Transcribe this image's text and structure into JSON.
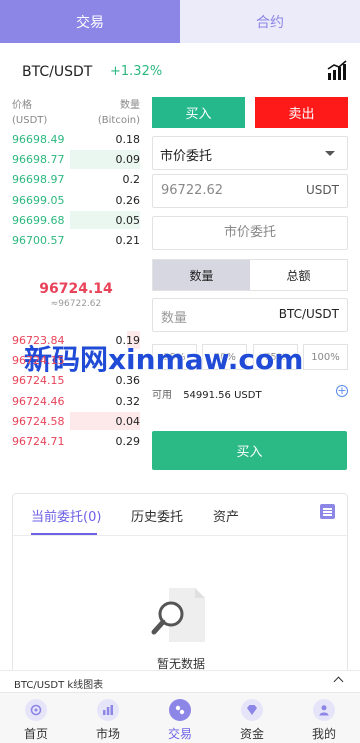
{
  "top_tabs": {
    "trade": "交易",
    "contract": "合约"
  },
  "pair": {
    "name": "BTC/USDT",
    "change": "+1.32%"
  },
  "orderbook": {
    "header_price": "价格",
    "header_price_unit": "(USDT)",
    "header_qty": "数量",
    "header_qty_unit": "(Bitcoin)",
    "asks": [
      {
        "price": "96698.49",
        "qty": "0.18",
        "depth": 0.0
      },
      {
        "price": "96698.77",
        "qty": "0.09",
        "depth": 0.55
      },
      {
        "price": "96698.97",
        "qty": "0.2",
        "depth": 0.0
      },
      {
        "price": "96699.05",
        "qty": "0.26",
        "depth": 0.0
      },
      {
        "price": "96699.68",
        "qty": "0.05",
        "depth": 0.55
      },
      {
        "price": "96700.57",
        "qty": "0.21",
        "depth": 0.0
      }
    ],
    "last_price": "96724.14",
    "last_price_approx": "≈96722.62",
    "bids": [
      {
        "price": "96723.84",
        "qty": "0.19",
        "depth": 0.1
      },
      {
        "price": "96724.15",
        "qty": "",
        "depth": 0.0
      },
      {
        "price": "96724.15",
        "qty": "0.36",
        "depth": 0.0
      },
      {
        "price": "96724.46",
        "qty": "0.32",
        "depth": 0.0
      },
      {
        "price": "96724.58",
        "qty": "0.04",
        "depth": 0.55
      },
      {
        "price": "96724.71",
        "qty": "0.29",
        "depth": 0.0
      }
    ]
  },
  "form": {
    "buy_label": "买入",
    "sell_label": "卖出",
    "order_type": "市价委托",
    "price_value": "96722.62",
    "price_unit": "USDT",
    "market_text": "市价委托",
    "mode_qty": "数量",
    "mode_total": "总额",
    "qty_placeholder": "数量",
    "qty_unit": "BTC/USDT",
    "percents": [
      "25%",
      "50%",
      "75%",
      "100%"
    ],
    "available_label": "可用",
    "available_value": "54991.56 USDT",
    "submit_label": "买入"
  },
  "watermark": "新码网xinmaw.com",
  "orders": {
    "tabs": [
      "当前委托(0)",
      "历史委托",
      "资产"
    ],
    "empty_text": "暂无数据"
  },
  "kline_bar": {
    "label": "BTC/USDT k线图表"
  },
  "nav": [
    "首页",
    "市场",
    "交易",
    "资金",
    "我的"
  ],
  "colors": {
    "accent": "#8c86e6",
    "buy": "#24b88a",
    "sell": "#ff1a1a",
    "up": "#2eb87f",
    "down": "#e94359"
  }
}
